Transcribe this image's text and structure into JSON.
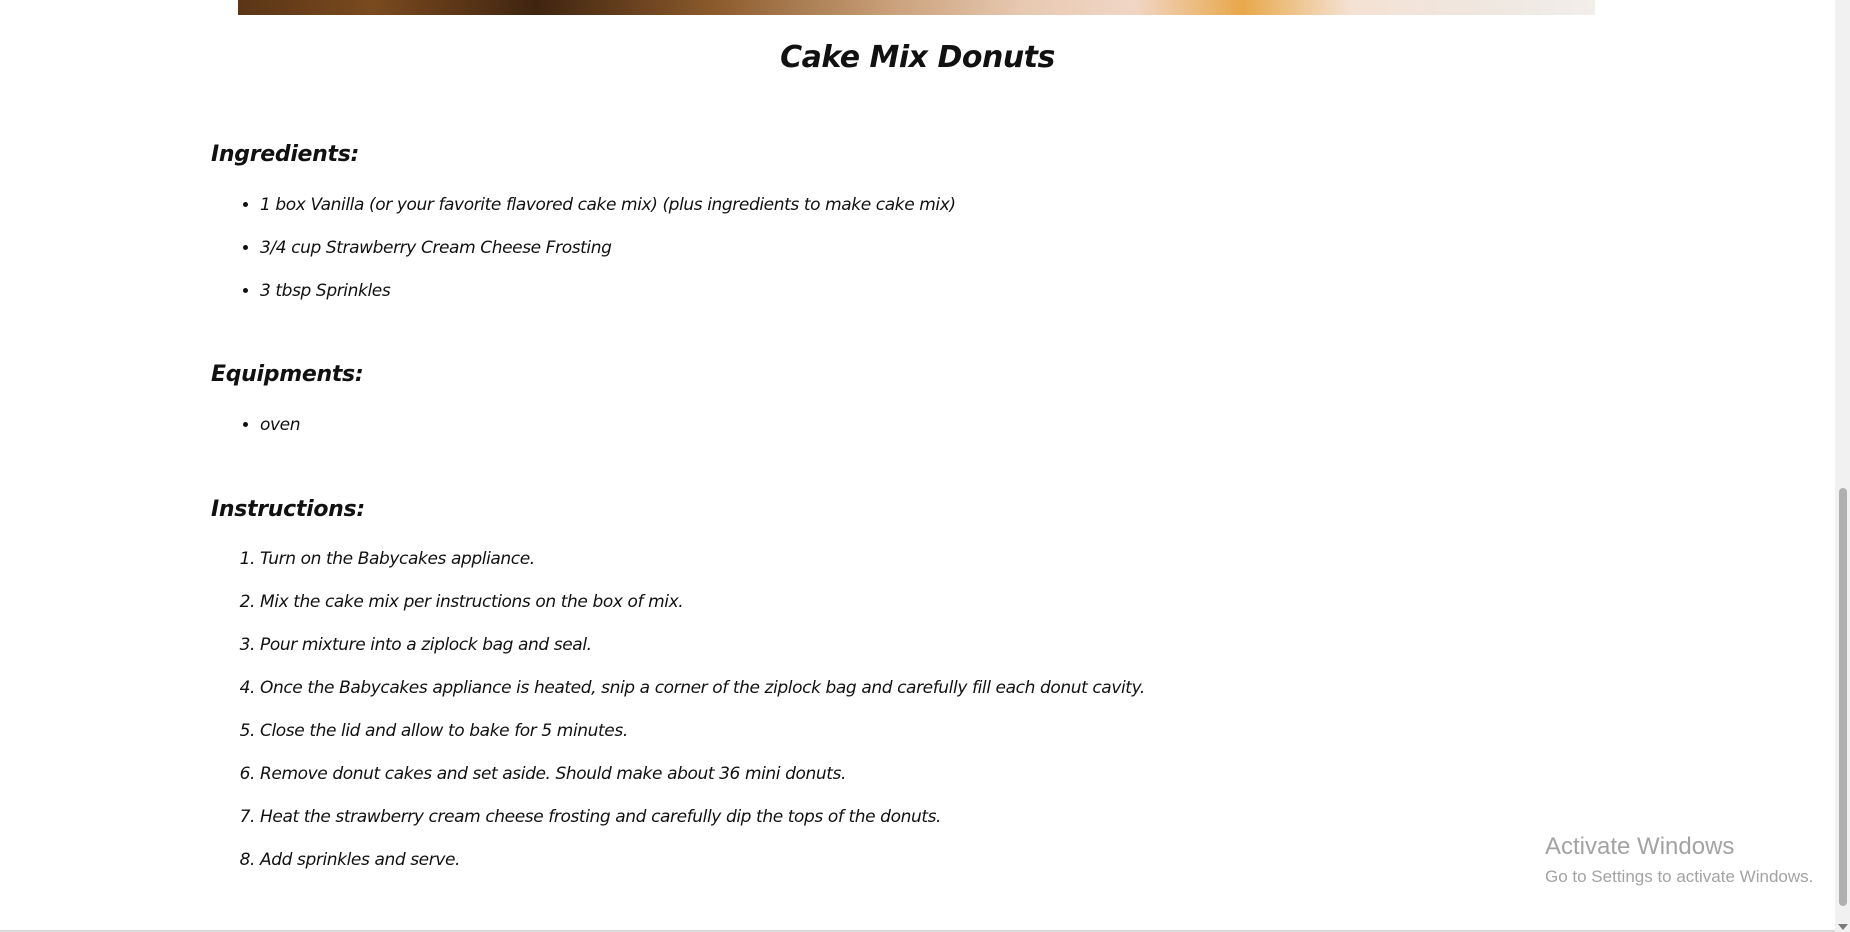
{
  "recipe": {
    "title": "Cake Mix Donuts"
  },
  "ingredients": {
    "heading": "Ingredients:",
    "items": [
      "1 box Vanilla (or your favorite flavored cake mix)  (plus ingredients to make cake mix)",
      "3/4 cup Strawberry Cream Cheese Frosting",
      "3 tbsp Sprinkles"
    ]
  },
  "equipments": {
    "heading": "Equipments:",
    "items": [
      "oven"
    ]
  },
  "instructions": {
    "heading": "Instructions:",
    "steps": [
      "Turn on the Babycakes appliance.",
      "Mix the cake mix per instructions on the box of mix.",
      "Pour mixture into a ziplock bag and seal.",
      "Once the Babycakes appliance is heated, snip a corner of the ziplock bag and carefully fill each donut cavity.",
      "Close the lid and allow to bake for 5 minutes.",
      "Remove donut cakes and set aside. Should make about 36 mini donuts.",
      "Heat the strawberry cream cheese frosting and carefully dip the tops of the donuts.",
      "Add sprinkles and serve."
    ]
  },
  "watermark": {
    "title": "Activate Windows",
    "subtitle": "Go to Settings to activate Windows."
  }
}
